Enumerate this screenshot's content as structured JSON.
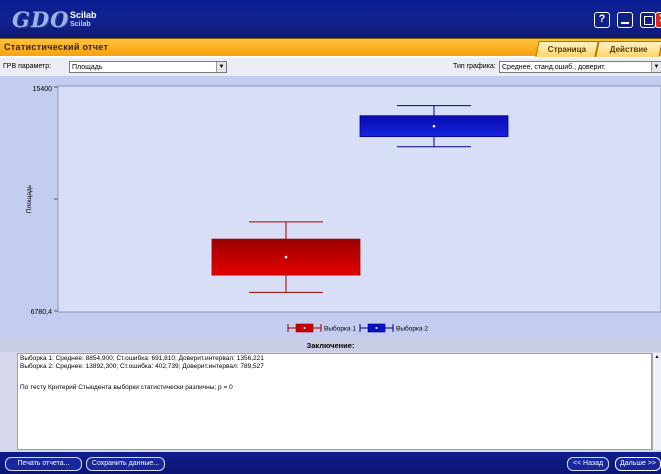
{
  "titlebar": {
    "logo_text": "GDO",
    "scilab_line1": "Scilab",
    "scilab_line2": "Scilab",
    "help_glyph": "?",
    "close_glyph": "✕",
    "icons": [
      "help-icon",
      "minimize-icon",
      "maximize-icon",
      "close-icon"
    ]
  },
  "header": {
    "title": "Статистический отчет",
    "tabs": [
      {
        "label": "Страница"
      },
      {
        "label": "Действие"
      }
    ],
    "accent_color": "#f6a20e"
  },
  "params": {
    "grv_label": "ГРВ параметр:",
    "grv_value": "Площадь",
    "chart_type_label": "Тип графика:",
    "chart_type_value": "Среднее, станд.ошиб., доверит."
  },
  "chart_data": {
    "type": "boxplot",
    "ylabel": "Площадь",
    "xlabel": "",
    "title": "",
    "ylim": [
      6780.4,
      15400
    ],
    "yticks": [
      "15400",
      "6780,4"
    ],
    "series": [
      {
        "name": "Выборка 1",
        "mean": 8854.9,
        "box_low": 8163.09,
        "box_high": 9546.71,
        "whisker_low": 7498.68,
        "whisker_high": 10211.12,
        "color": "#c40000"
      },
      {
        "name": "Выборка 2",
        "mean": 13892.3,
        "box_low": 13489.56,
        "box_high": 14295.04,
        "whisker_low": 13102.77,
        "whisker_high": 14681.83,
        "color": "#0a10c8"
      }
    ],
    "grid": false,
    "legend": "bottom-center"
  },
  "conclusion": {
    "title": "Заключение:",
    "lines": [
      "Выборка 1: Среднее: 8854,900; Ст.ошибка: 691,810; Доверит.интервал: 1356,221",
      "Выборка 2: Среднее: 13892,300; Ст.ошибка: 402,739; Доверит.интервал: 789,527",
      "По тесту Критерий Стьюдента выборки статистически различны; p = 0"
    ]
  },
  "footer": {
    "print_label": "Печать отчета...",
    "save_label": "Сохранить данные...",
    "back_label": "<< Назад",
    "next_label": "Дальше >>"
  }
}
